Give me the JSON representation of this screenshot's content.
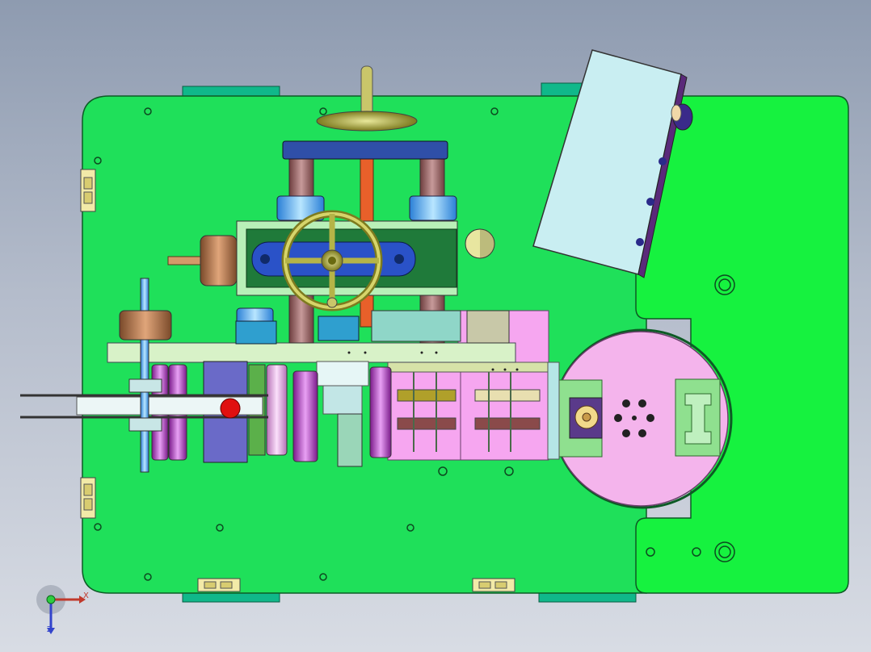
{
  "window": {
    "background_top": "#8e9bb0",
    "background_bottom": "#d8dce4"
  },
  "model": {
    "base_plate_color": "#1fe05a",
    "side_plate_color": "#16f23f",
    "turntable_color": "#f4b4ec",
    "frame_color": "#2f4fa8",
    "handwheel_color": "#b5b447",
    "monitor_color": "#c9eef2"
  },
  "triad": {
    "x_label": "X",
    "z_label": "Z",
    "x_color": "#c0392b",
    "y_color": "#2ecc40",
    "z_color": "#3344cc"
  }
}
